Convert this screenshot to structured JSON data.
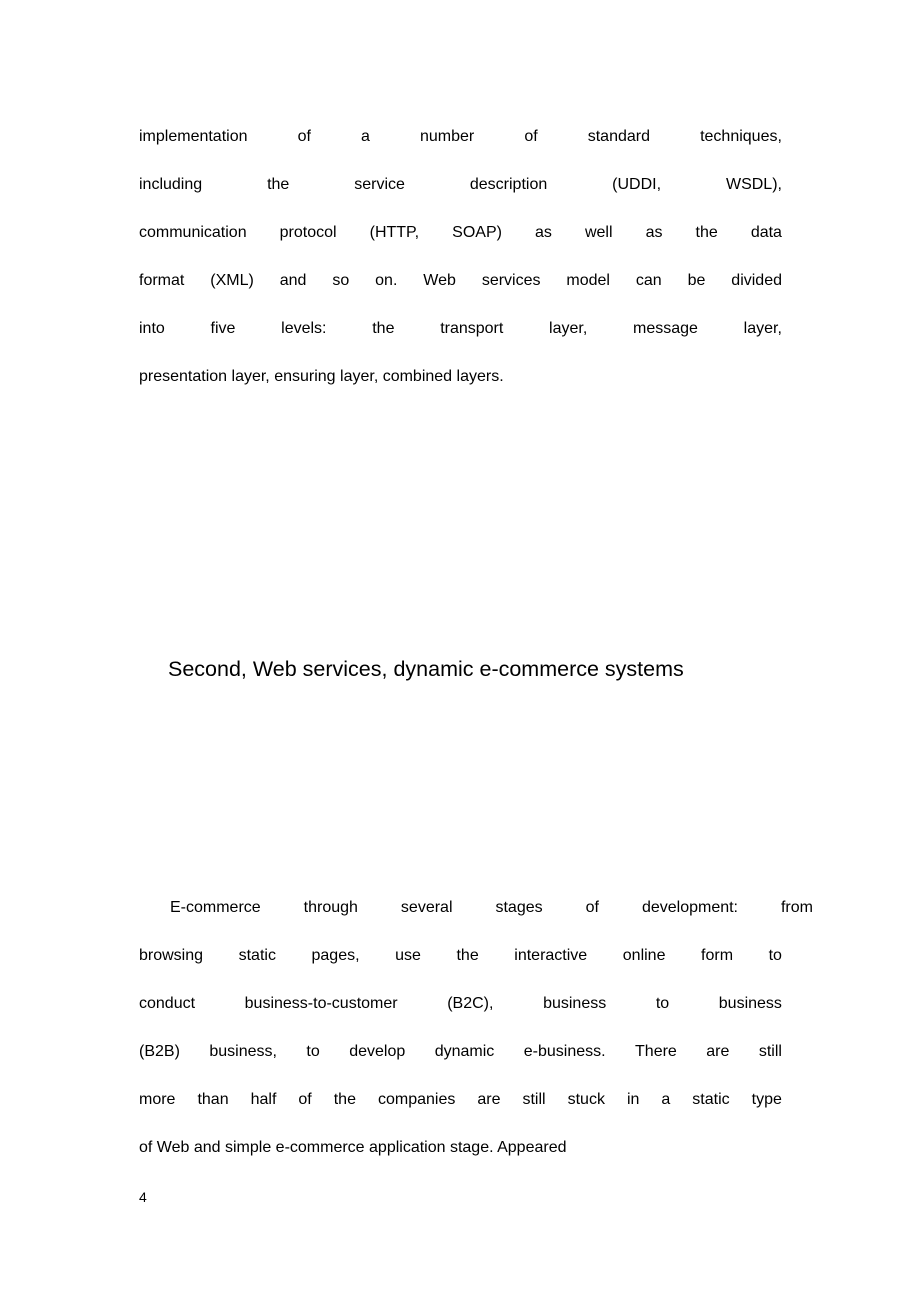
{
  "document": {
    "page_number": "4",
    "background_color": "#ffffff",
    "text_color": "#000000",
    "paragraph_1": {
      "full_text": "implementation of a number of standard techniques, including the service description (UDDI, WSDL), communication protocol (HTTP, SOAP) as well as the data format (XML) and so on. Web services model can be divided into five levels: the transport layer, message layer, presentation layer, ensuring layer, combined layers.",
      "lines": [
        "implementation of a number of standard techniques,",
        "including the service description (UDDI, WSDL),",
        "communication protocol (HTTP, SOAP) as well as the data",
        "format (XML) and so on. Web services model can be divided",
        "into five levels: the transport layer, message layer,",
        "presentation layer, ensuring layer, combined layers."
      ]
    },
    "heading": {
      "text": "Second, Web services, dynamic e-commerce systems"
    },
    "paragraph_2": {
      "full_text": "E-commerce through several stages of development: from browsing static pages, use the interactive online form to conduct business-to-customer (B2C), business to business (B2B) business, to develop dynamic e-business. There are still more than half of the companies are still stuck in a static type of Web and simple e-commerce application stage. Appeared",
      "lines": [
        "E-commerce through several stages of development: from",
        "browsing static pages, use the interactive online form to",
        "conduct business-to-customer (B2C), business to business",
        "(B2B) business, to develop dynamic e-business. There are still",
        "more than half of the companies are still stuck in a static type",
        "of Web and simple e-commerce application stage. Appeared"
      ]
    }
  }
}
